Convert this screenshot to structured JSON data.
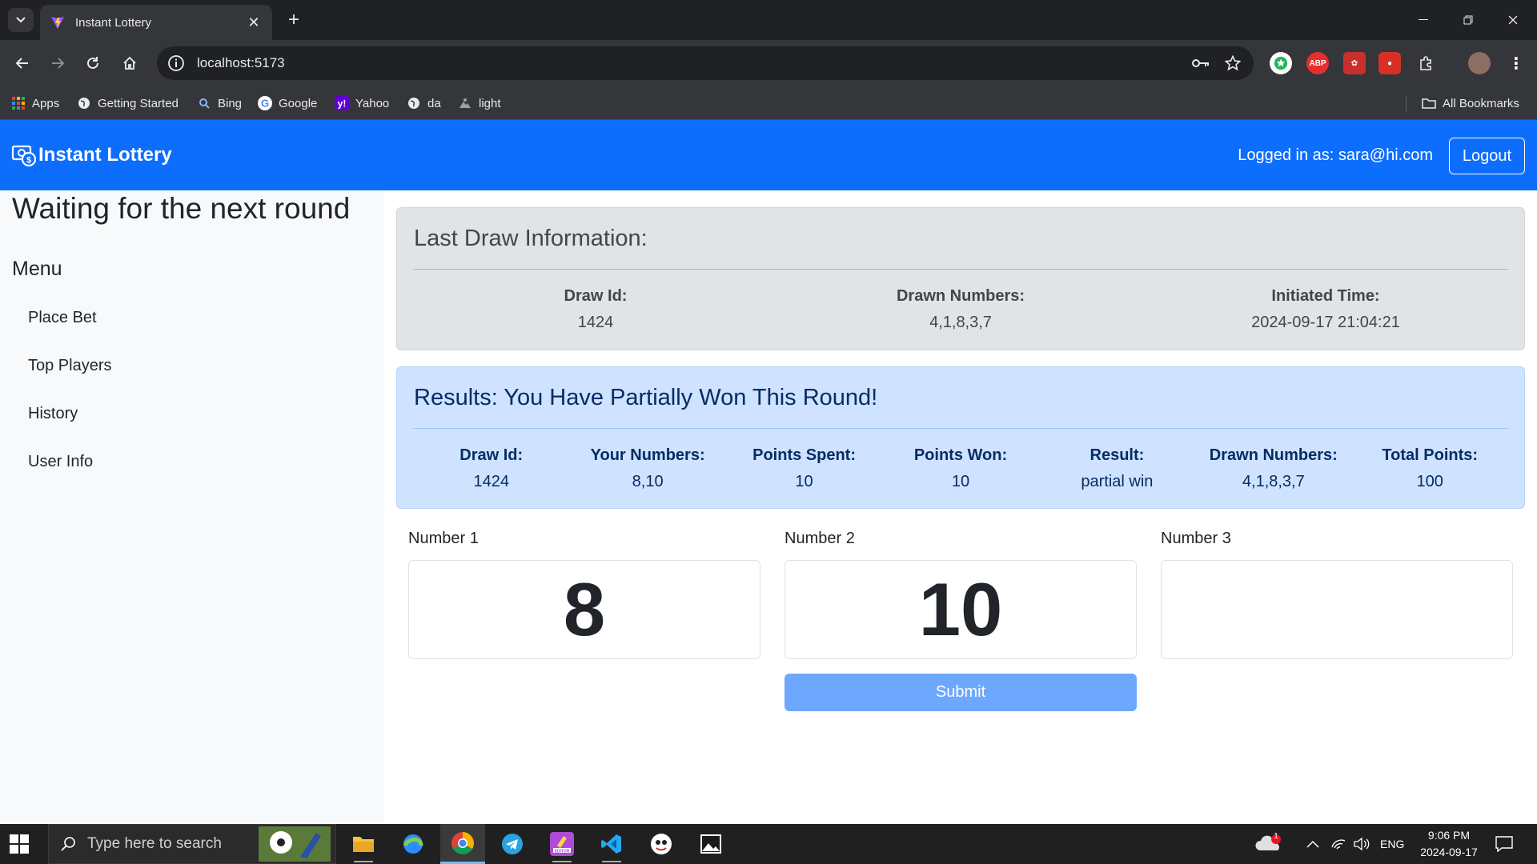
{
  "browser": {
    "tab_title": "Instant Lottery",
    "url": "localhost:5173",
    "bookmarks": [
      {
        "label": "Apps",
        "icon": "apps-grid-icon"
      },
      {
        "label": "Getting Started",
        "icon": "globe-icon"
      },
      {
        "label": "Bing",
        "icon": "search-icon"
      },
      {
        "label": "Google",
        "icon": "google-icon"
      },
      {
        "label": "Yahoo",
        "icon": "yahoo-icon"
      },
      {
        "label": "da",
        "icon": "globe-icon"
      },
      {
        "label": "light",
        "icon": "light-icon"
      }
    ],
    "all_bookmarks": "All Bookmarks"
  },
  "app": {
    "brand": "Instant Lottery",
    "logged_in": "Logged in as: sara@hi.com",
    "logout": "Logout",
    "colors": {
      "primary": "#0d6efd",
      "submit": "#6ea8fe",
      "result_bg": "#cfe2ff",
      "info_bg": "#e2e3e5"
    }
  },
  "sidebar": {
    "status": "Waiting for the next round",
    "menu_title": "Menu",
    "items": [
      "Place Bet",
      "Top Players",
      "History",
      "User Info"
    ]
  },
  "last_draw": {
    "heading": "Last Draw Information:",
    "columns": [
      {
        "label": "Draw Id:",
        "value": "1424"
      },
      {
        "label": "Drawn Numbers:",
        "value": "4,1,8,3,7"
      },
      {
        "label": "Initiated Time:",
        "value": "2024-09-17 21:04:21"
      }
    ]
  },
  "results": {
    "heading": "Results: You Have Partially Won This Round!",
    "columns": [
      {
        "label": "Draw Id:",
        "value": "1424"
      },
      {
        "label": "Your Numbers:",
        "value": "8,10"
      },
      {
        "label": "Points Spent:",
        "value": "10"
      },
      {
        "label": "Points Won:",
        "value": "10"
      },
      {
        "label": "Result:",
        "value": "partial win"
      },
      {
        "label": "Drawn Numbers:",
        "value": "4,1,8,3,7"
      },
      {
        "label": "Total Points:",
        "value": "100"
      }
    ]
  },
  "bet": {
    "numbers": [
      {
        "label": "Number 1",
        "value": "8"
      },
      {
        "label": "Number 2",
        "value": "10"
      },
      {
        "label": "Number 3",
        "value": ""
      }
    ],
    "submit": "Submit"
  },
  "taskbar": {
    "search_placeholder": "Type here to search",
    "language": "ENG",
    "time": "9:06 PM",
    "date": "2024-09-17",
    "notification_count": "1"
  }
}
